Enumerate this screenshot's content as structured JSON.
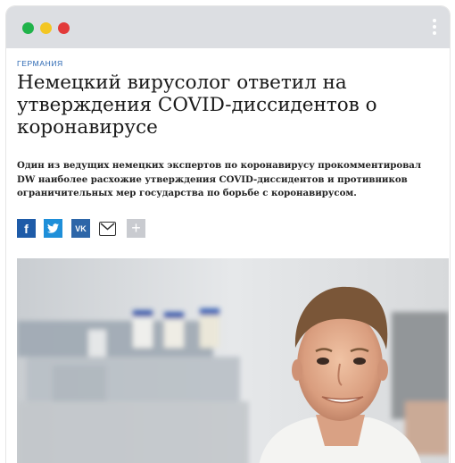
{
  "window": {
    "controls": [
      "close",
      "minimize",
      "maximize"
    ],
    "menu_icon": "more-vertical-icon"
  },
  "article": {
    "kicker": "ГЕРМАНИЯ",
    "headline": "Немецкий вирусолог ответил на утверждения COVID-диссидентов о коронавирусе",
    "lead": "Один из ведущих немецких экспертов по коронавирусу прокомментировал DW наиболее расхожие утверждения COVID-диссидентов и противников ограничительных мер государства по борьбе с коронавирусом."
  },
  "share": {
    "facebook_icon": "facebook-icon",
    "twitter_icon": "twitter-icon",
    "vk_label": "VK",
    "mail_icon": "mail-icon",
    "more_icon": "plus-icon"
  },
  "photo": {
    "subject": "portrait-photo"
  },
  "colors": {
    "kicker": "#2a67b3",
    "facebook": "#1e5ba8",
    "twitter": "#1e8fd9",
    "vk": "#2d66a8"
  }
}
